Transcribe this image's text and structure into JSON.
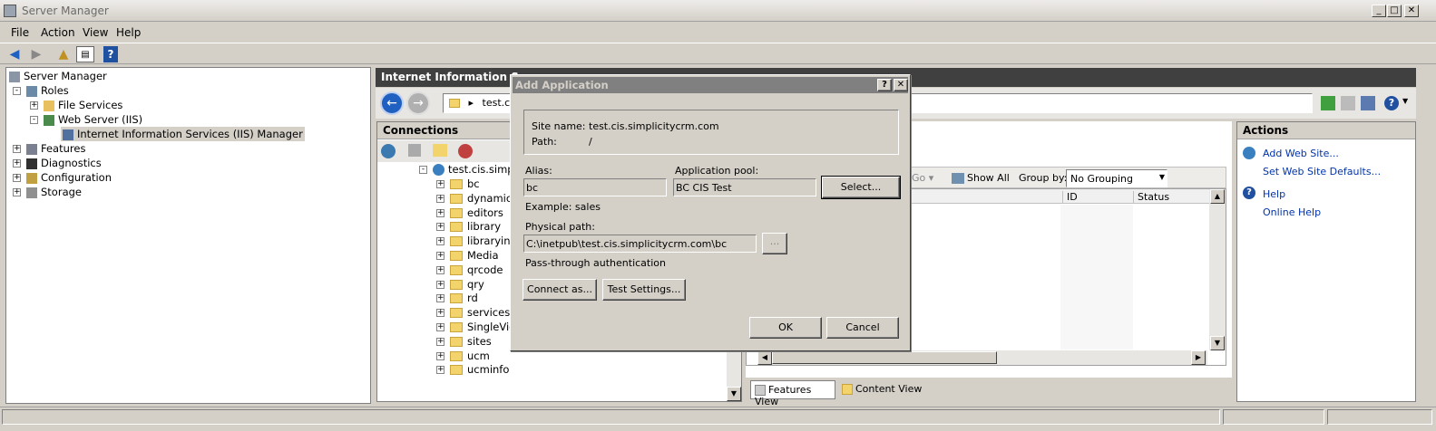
{
  "window": {
    "title": "Server Manager"
  },
  "menu": [
    "File",
    "Action",
    "View",
    "Help"
  ],
  "left_tree": {
    "root": "Server Manager",
    "roles": "Roles",
    "file_services": "File Services",
    "web_server": "Web Server (IIS)",
    "iis_manager": "Internet Information Services (IIS) Manager",
    "features": "Features",
    "diagnostics": "Diagnostics",
    "configuration": "Configuration",
    "storage": "Storage"
  },
  "iis": {
    "header": "Internet Information Serv",
    "address": "test.c",
    "connections": "Connections",
    "site": "test.cis.simplic",
    "folders": [
      "bc",
      "dynamicp",
      "editors",
      "library",
      "libraryinfo",
      "Media",
      "qrcode",
      "qry",
      "rd",
      "services",
      "SingleView",
      "sites",
      "ucm",
      "ucminfo"
    ],
    "go_label": "Go",
    "show_all": "Show All",
    "group_by_label": "Group by:",
    "group_by_value": "No Grouping",
    "col_id": "ID",
    "col_status": "Status",
    "features_view": "Features View",
    "content_view": "Content View"
  },
  "actions": {
    "header": "Actions",
    "add_site": "Add Web Site...",
    "set_defaults": "Set Web Site Defaults...",
    "help": "Help",
    "online_help": "Online Help"
  },
  "dialog": {
    "title": "Add Application",
    "site_name_label": "Site name:",
    "site_name": "test.cis.simplicitycrm.com",
    "path_label": "Path:",
    "path": "/",
    "alias_label": "Alias:",
    "alias": "bc",
    "pool_label": "Application pool:",
    "pool": "BC CIS Test",
    "select": "Select...",
    "example": "Example: sales",
    "physical_label": "Physical path:",
    "physical": "C:\\inetpub\\test.cis.simplicitycrm.com\\bc",
    "browse": "...",
    "passthrough": "Pass-through authentication",
    "connect_as": "Connect as...",
    "test_settings": "Test Settings...",
    "ok": "OK",
    "cancel": "Cancel",
    "help_btn": "?",
    "close_btn": "✕"
  },
  "colors": {
    "accent": "#0a246a",
    "dialog_title": "#808080",
    "link": "#0033aa",
    "header_dark": "#404040"
  }
}
